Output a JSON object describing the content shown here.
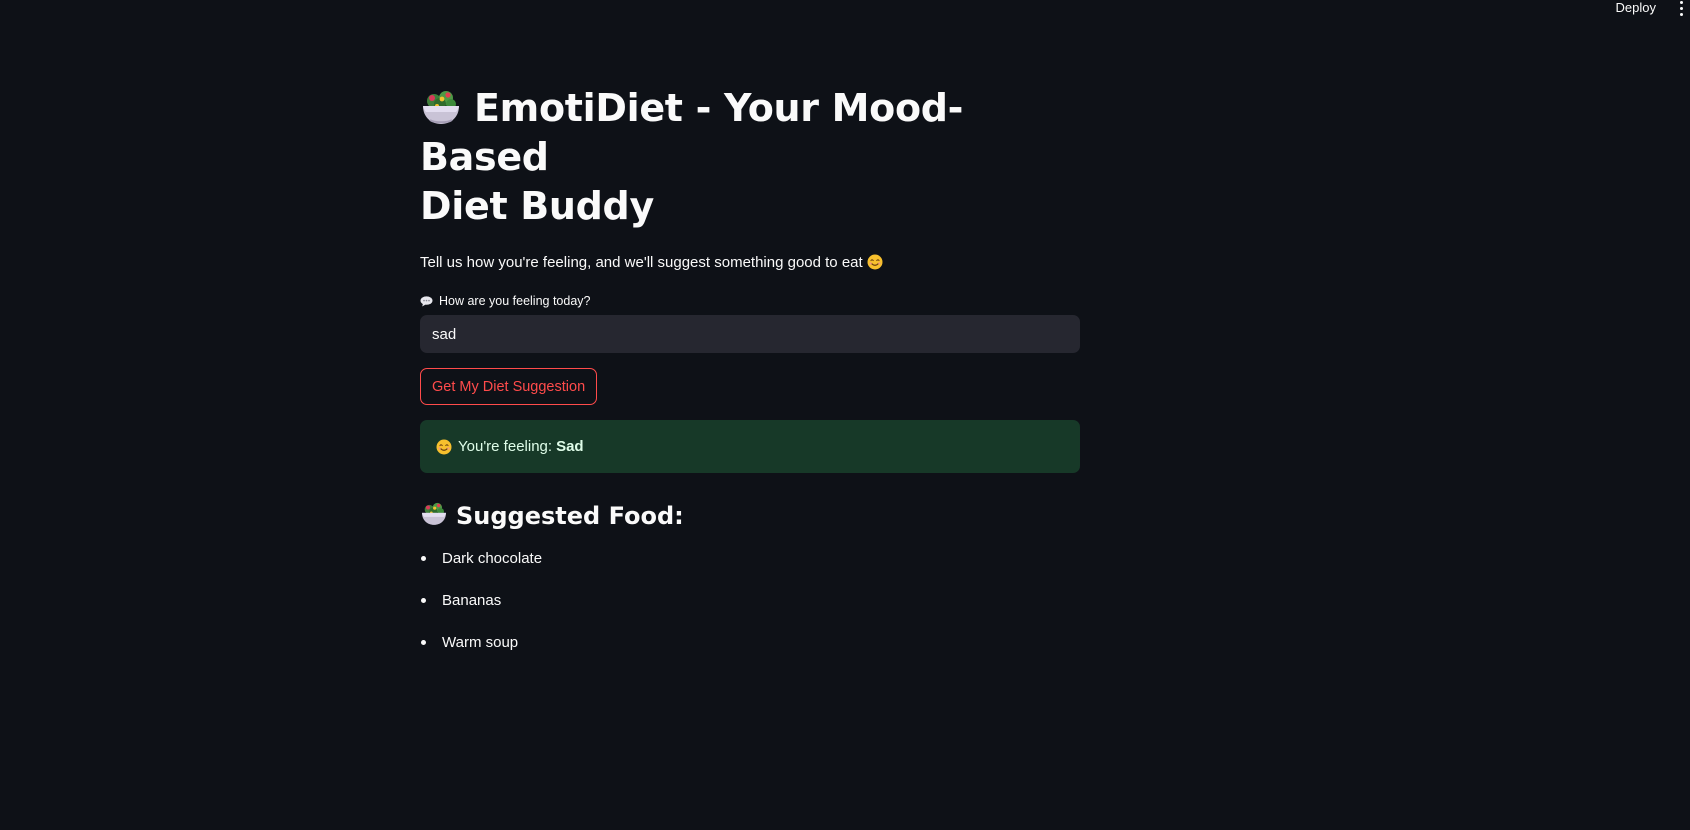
{
  "topbar": {
    "deploy_label": "Deploy",
    "menu_icon": "vertical-ellipsis-icon"
  },
  "header": {
    "title_icon": "green-salad-bowl-icon",
    "title_line1": "EmotiDiet - Your Mood-Based",
    "title_line2": "Diet Buddy",
    "subtitle": "Tell us how you're feeling, and we'll suggest something good to eat",
    "subtitle_icon": "smiling-face-icon"
  },
  "form": {
    "label_icon": "speech-balloon-icon",
    "label": "How are you feeling today?",
    "input_value": "sad",
    "submit_label": "Get My Diet Suggestion"
  },
  "result": {
    "icon": "smiling-face-icon",
    "prefix": "You're feeling:",
    "mood": "Sad"
  },
  "suggestions": {
    "icon": "green-salad-bowl-icon",
    "title": "Suggested Food:",
    "items": [
      "Dark chocolate",
      "Bananas",
      "Warm soup"
    ]
  },
  "colors": {
    "background": "#0e1117",
    "text": "#fafafa",
    "input_bg": "#262730",
    "accent": "#ff4b4b",
    "success_bg": "#173928",
    "success_text": "#dffde9"
  }
}
